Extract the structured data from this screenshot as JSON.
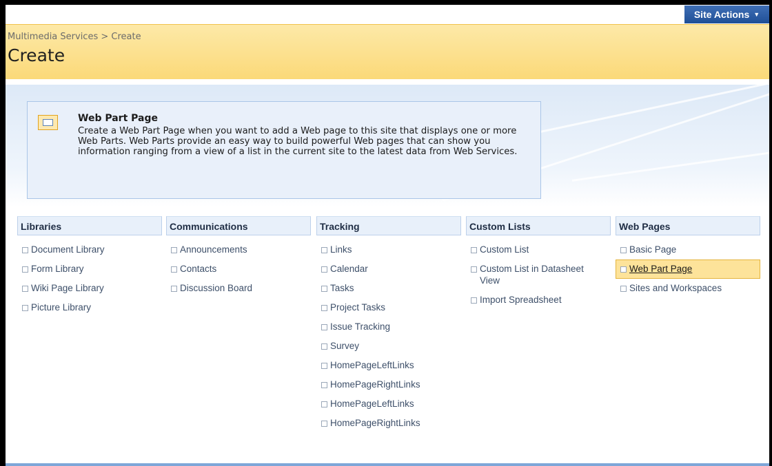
{
  "header": {
    "site_actions": "Site Actions"
  },
  "breadcrumb": {
    "site": "Multimedia Services",
    "separator": ">",
    "current": "Create"
  },
  "page": {
    "title": "Create"
  },
  "description": {
    "title": "Web Part Page",
    "text": "Create a Web Part Page when you want to add a Web page to this site that displays one or more Web Parts. Web Parts provide an easy way to build powerful Web pages that can show you information ranging from a view of a list in the current site to the latest data from Web Services."
  },
  "columns": [
    {
      "title": "Libraries",
      "items": [
        "Document Library",
        "Form Library",
        "Wiki Page Library",
        "Picture Library"
      ]
    },
    {
      "title": "Communications",
      "items": [
        "Announcements",
        "Contacts",
        "Discussion Board"
      ]
    },
    {
      "title": "Tracking",
      "items": [
        "Links",
        "Calendar",
        "Tasks",
        "Project Tasks",
        "Issue Tracking",
        "Survey",
        "HomePageLeftLinks",
        "HomePageRightLinks",
        "HomePageLeftLinks",
        "HomePageRightLinks"
      ]
    },
    {
      "title": "Custom Lists",
      "items": [
        "Custom List",
        "Custom List in Datasheet View",
        "Import Spreadsheet"
      ]
    },
    {
      "title": "Web Pages",
      "items": [
        "Basic Page",
        "Web Part Page",
        "Sites and Workspaces"
      ]
    }
  ],
  "selected_item": "Web Part Page",
  "colors": {
    "title_band": "#fbd978",
    "site_actions": "#2a5aa0",
    "highlight": "#fde39a"
  }
}
